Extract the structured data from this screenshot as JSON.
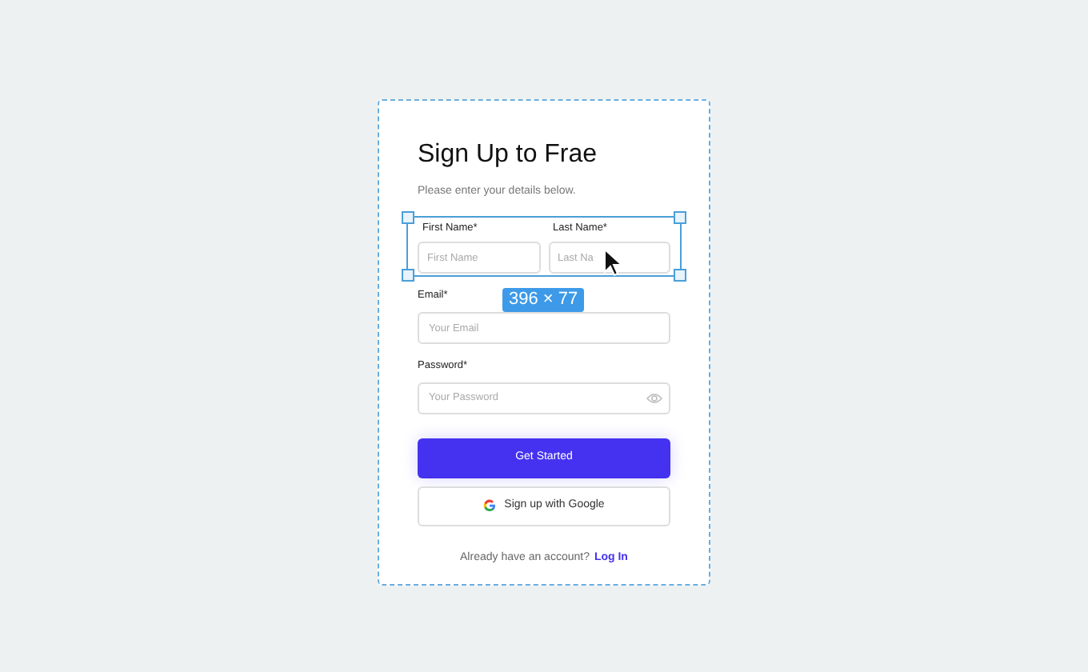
{
  "title": "Sign Up to Frae",
  "subtitle": "Please enter your details below.",
  "name_fields": [
    {
      "label": "First Name*",
      "placeholder": "First Name"
    },
    {
      "label": "Last Name*",
      "placeholder": "Last Na"
    }
  ],
  "fields": [
    {
      "label": "Email*",
      "placeholder": "Your Email",
      "kind": "text"
    },
    {
      "label": "Password*",
      "placeholder": "Your Password",
      "kind": "password"
    }
  ],
  "primary_button": "Get Started",
  "google_button": "Sign up with Google",
  "footer": {
    "text": "Already have an account?",
    "link": "Log In"
  },
  "selection": {
    "dimensions": "396 × 77"
  }
}
